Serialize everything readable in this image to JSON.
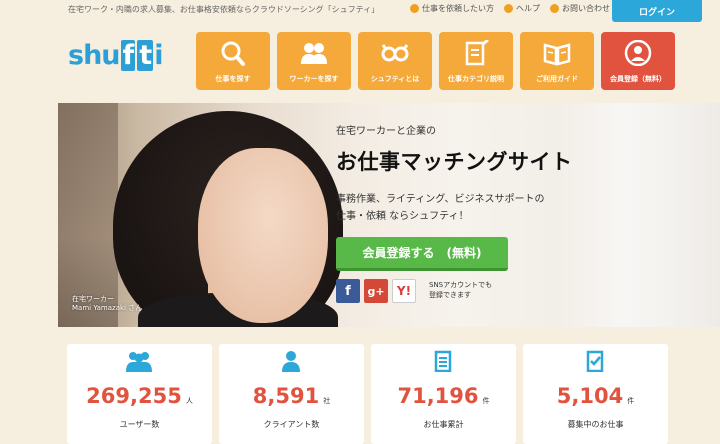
{
  "header": {
    "tagline": "在宅ワーク・内職の求人募集、お仕事格安依頼ならクラウドソーシング「シュフティ」",
    "links": [
      {
        "label": "仕事を依頼したい方",
        "icon": "arrow-circle-icon"
      },
      {
        "label": "ヘルプ",
        "icon": "help-icon"
      },
      {
        "label": "お問い合わせ",
        "icon": "mail-icon"
      }
    ],
    "login_label": "ログイン",
    "logo_text": [
      "shu",
      "f",
      "t",
      "i"
    ]
  },
  "nav": [
    {
      "label": "仕事を探す",
      "icon": "search-icon"
    },
    {
      "label": "ワーカーを探す",
      "icon": "users-icon"
    },
    {
      "label": "シュフティとは",
      "icon": "owl-icon"
    },
    {
      "label": "仕事カテゴリ説明",
      "icon": "document-pen-icon"
    },
    {
      "label": "ご利用ガイド",
      "icon": "book-icon"
    },
    {
      "label": "会員登録（無料）",
      "icon": "person-icon"
    }
  ],
  "hero": {
    "pre": "在宅ワーカーと企業の",
    "headline": "お仕事マッチングサイト",
    "desc1": "事務作業、ライティング、ビジネスサポートの",
    "desc2": "仕事・依頼 ならシュフティ！",
    "signup_label": "会員登録する　(無料)",
    "sns_note1": "SNSアカウントでも",
    "sns_note2": "登録できます",
    "credit1": "在宅ワーカー",
    "credit2": "Mami Yamazaki さん"
  },
  "stats": [
    {
      "num": "269,255",
      "unit": "人",
      "caption": "ユーザー数",
      "icon": "users-icon"
    },
    {
      "num": "8,591",
      "unit": "社",
      "caption": "クライアント数",
      "icon": "person-icon"
    },
    {
      "num": "71,196",
      "unit": "件",
      "caption": "お仕事累計",
      "icon": "clipboard-icon"
    },
    {
      "num": "5,104",
      "unit": "件",
      "caption": "募集中のお仕事",
      "icon": "checklist-icon"
    }
  ],
  "colors": {
    "accent": "#2ba7d9",
    "nav": "#f4a93a",
    "register": "#e2533f",
    "signup": "#58b948"
  }
}
